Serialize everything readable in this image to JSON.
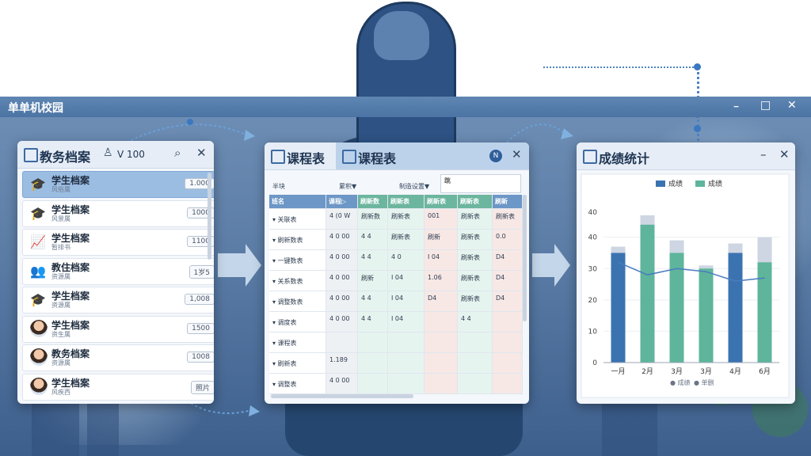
{
  "app_title": "单单机校园",
  "window_controls": {
    "min": "ｰ",
    "max": "□",
    "close": "✕"
  },
  "left_window": {
    "title": "教务档案",
    "user_label": "V 100",
    "items": [
      {
        "name": "学生档案",
        "sub": "风俗属",
        "badge": "1.000",
        "icon": "graduation-cap-icon",
        "glyph": "🎓"
      },
      {
        "name": "学生档案",
        "sub": "风景属",
        "badge": "1000",
        "icon": "graduation-cap-icon",
        "glyph": "🎓"
      },
      {
        "name": "学生档案",
        "sub": "暂排书",
        "badge": "1100",
        "icon": "chart-card-icon",
        "glyph": "📈"
      },
      {
        "name": "教住档案",
        "sub": "资源属",
        "badge": "1岁5",
        "icon": "people-icon",
        "glyph": "👥"
      },
      {
        "name": "学生档案",
        "sub": "资源属",
        "badge": "1,008",
        "icon": "graduation-cap-icon",
        "glyph": "🎓"
      },
      {
        "name": "学生档案",
        "sub": "资生属",
        "badge": "1500",
        "icon": "avatar",
        "glyph": ""
      },
      {
        "name": "教务档案",
        "sub": "资源属",
        "badge": "1008",
        "icon": "avatar",
        "glyph": ""
      },
      {
        "name": "学生档案",
        "sub": "风疾西",
        "badge": "照片",
        "icon": "avatar",
        "glyph": ""
      }
    ]
  },
  "middle_window": {
    "title": "课程表",
    "tab_label": "课程表",
    "tab_btn": "N",
    "filter_left": "累积▼",
    "filter_mid": "制造设置▼",
    "filter_right": "跳",
    "corner_label": "半块",
    "headers": [
      "班名",
      "课程▷",
      "刷新数",
      "刷新表",
      "刷新表",
      "刷新表",
      "刷新"
    ],
    "rows": [
      {
        "label": "关联表",
        "c": [
          "4 (0 W",
          "刷新数",
          "刷新表",
          "001",
          "刷新表",
          "刷新表"
        ]
      },
      {
        "label": "刷新数表",
        "c": [
          "4 0 00",
          "4 4",
          "刷新表",
          "刷新",
          "刷新表",
          "0.0"
        ]
      },
      {
        "label": "一键数表",
        "c": [
          "4 0 00",
          "4 4",
          "4 0",
          "I 04",
          "刷新表",
          "D4"
        ]
      },
      {
        "label": "关系数表",
        "c": [
          "4 0 00",
          "刷新",
          "I 04",
          "1.06",
          "刷新表",
          "D4"
        ]
      },
      {
        "label": "调整数表",
        "c": [
          "4 0 00",
          "4 4",
          "I 04",
          "D4",
          "刷新表",
          "D4"
        ]
      },
      {
        "label": "调度表",
        "c": [
          "4 0 00",
          "4 4",
          "I 04",
          "",
          "4 4",
          ""
        ]
      },
      {
        "label": "课程表",
        "c": [
          "",
          "",
          "",
          "",
          "",
          ""
        ]
      },
      {
        "label": "刷新表",
        "c": [
          "1.189",
          "",
          "",
          "",
          "",
          ""
        ]
      },
      {
        "label": "调整表",
        "c": [
          "4 0 00",
          "",
          "",
          "",
          "",
          ""
        ]
      }
    ]
  },
  "right_window": {
    "title": "成绩统计",
    "legend": [
      "成绩",
      "成绩"
    ],
    "footer_legend": [
      "● 成绩",
      "● 单删"
    ]
  },
  "chart_data": {
    "type": "bar",
    "categories": [
      "一月",
      "2月",
      "3月",
      "3月",
      "4月",
      "6月"
    ],
    "series": [
      {
        "name": "成绩",
        "values": [
          35,
          null,
          null,
          null,
          35,
          null
        ]
      },
      {
        "name": "成绩",
        "values": [
          null,
          44,
          35,
          30,
          null,
          32
        ]
      }
    ],
    "totals": [
      37,
      47,
      39,
      31,
      38,
      40
    ],
    "line_values": [
      32,
      28,
      30,
      29,
      26,
      27
    ],
    "ylim": [
      0,
      40
    ],
    "yticks": [
      0,
      10,
      20,
      30,
      40
    ],
    "ytick_labels": [
      "0",
      "10",
      "20",
      "30",
      "40",
      "40"
    ],
    "colors": {
      "blue": "#3b73b1",
      "green": "#5eb59c",
      "gray": "#cdd6e2",
      "line": "#4a7bc0"
    }
  }
}
